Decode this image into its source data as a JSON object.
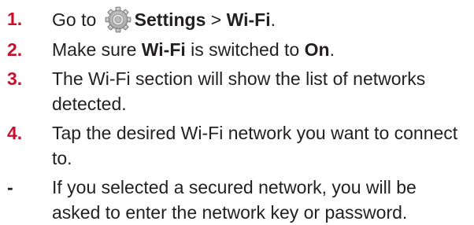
{
  "steps": [
    {
      "marker": "1.",
      "parts": [
        {
          "t": "Go to "
        },
        {
          "icon": "settings-gear-icon"
        },
        {
          "t": "Settings",
          "b": true
        },
        {
          "t": " > "
        },
        {
          "t": "Wi-Fi",
          "b": true
        },
        {
          "t": "."
        }
      ]
    },
    {
      "marker": "2.",
      "parts": [
        {
          "t": "Make sure "
        },
        {
          "t": "Wi-Fi",
          "b": true
        },
        {
          "t": " is switched to "
        },
        {
          "t": "On",
          "b": true
        },
        {
          "t": "."
        }
      ]
    },
    {
      "marker": "3.",
      "parts": [
        {
          "t": "The Wi-Fi section will show the list of networks detected."
        }
      ]
    },
    {
      "marker": "4.",
      "parts": [
        {
          "t": "Tap the desired Wi-Fi network you want to connect to."
        }
      ]
    },
    {
      "marker": "-",
      "parts": [
        {
          "t": "If you selected a secured network, you will be asked to enter the network key or password."
        }
      ]
    }
  ],
  "colors": {
    "number_marker": "#c8102e",
    "text": "#231f20"
  }
}
